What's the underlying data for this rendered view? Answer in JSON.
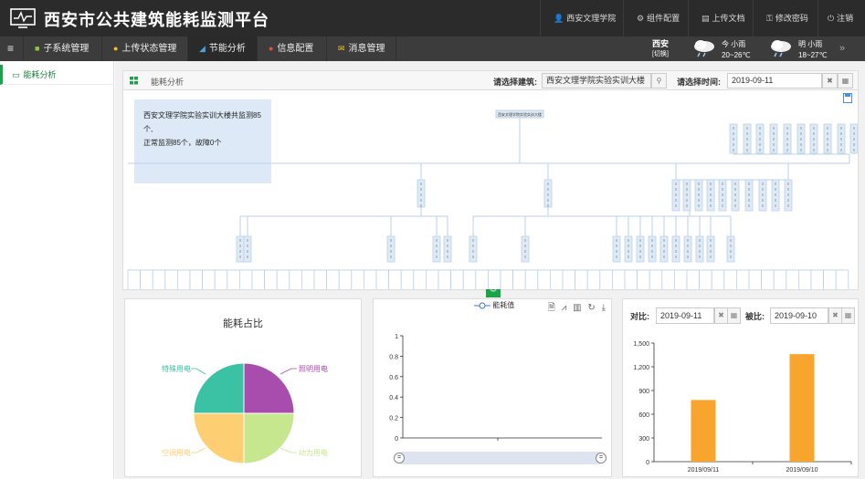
{
  "app": {
    "title": "西安市公共建筑能耗监测平台"
  },
  "topbar": {
    "org": "西安文理学院",
    "component_config": "组件配置",
    "upload_doc": "上传文档",
    "change_password": "修改密码",
    "logout": "注销"
  },
  "nav": {
    "items": [
      {
        "label": "子系统管理",
        "icon": "grid-icon"
      },
      {
        "label": "上传状态管理",
        "icon": "info-icon"
      },
      {
        "label": "节能分析",
        "icon": "chart-icon"
      },
      {
        "label": "信息配置",
        "icon": "record-icon"
      },
      {
        "label": "消息管理",
        "icon": "mail-icon"
      }
    ],
    "active": 2
  },
  "weather": {
    "city": "西安",
    "switch": "[切换]",
    "today": {
      "day": "今",
      "cond": "小雨",
      "temp": "20~26℃"
    },
    "tomorrow": {
      "day": "明",
      "cond": "小雨",
      "temp": "18~27℃"
    },
    "more": "»"
  },
  "sidebar": {
    "items": [
      {
        "label": "能耗分析",
        "icon": "monitor-icon"
      }
    ]
  },
  "panel": {
    "title": "能耗分析",
    "building_label": "请选择建筑:",
    "building_value": "西安文理学院实验实训大楼",
    "time_label": "请选择时间:",
    "time_value": "2019-09-11"
  },
  "tree": {
    "summary_line1": "西安文理学院实验实训大楼共监测85个,",
    "summary_line2": "正常监测85个，故障0个",
    "root_label": "西安文理学院实验实训大楼"
  },
  "pie": {
    "title": "能耗占比",
    "labels": [
      "照明用电",
      "动力用电",
      "空调用电",
      "特殊用电"
    ],
    "colors": [
      "#a84dad",
      "#c6e78e",
      "#fece72",
      "#3bc2a4"
    ]
  },
  "line": {
    "legend": "能耗值",
    "yticks": [
      "0",
      "0.2",
      "0.4",
      "0.6",
      "0.8",
      "1"
    ]
  },
  "compare": {
    "compare_label": "对比:",
    "compare_value": "2019-09-11",
    "base_label": "被比:",
    "base_value": "2019-09-10"
  },
  "chart_data": {
    "type": "bar",
    "categories": [
      "2019/09/11",
      "2019/09/10"
    ],
    "values": [
      780,
      1360
    ],
    "yticks": [
      "0",
      "300",
      "600",
      "900",
      "1,200",
      "1,500"
    ],
    "ylim": [
      0,
      1500
    ],
    "color": "#f8a52e"
  }
}
